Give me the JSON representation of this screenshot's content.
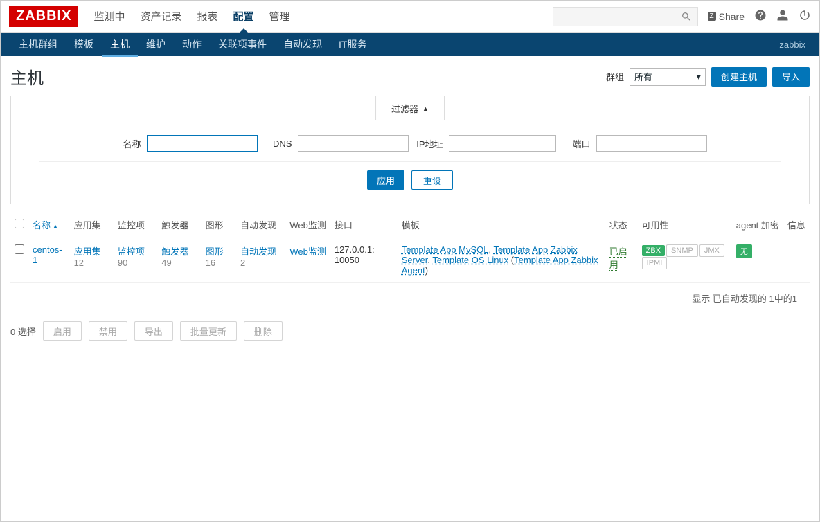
{
  "logo": "ZABBIX",
  "mainnav": {
    "items": [
      "监测中",
      "资产记录",
      "报表",
      "配置",
      "管理"
    ],
    "active_index": 3
  },
  "toptools": {
    "share": "Share",
    "share_badge": "Z"
  },
  "subnav": {
    "items": [
      "主机群组",
      "模板",
      "主机",
      "维护",
      "动作",
      "关联项事件",
      "自动发现",
      "IT服务"
    ],
    "active_index": 2,
    "right": "zabbix"
  },
  "page": {
    "title": "主机",
    "group_label": "群组",
    "group_value": "所有",
    "create_btn": "创建主机",
    "import_btn": "导入"
  },
  "filter": {
    "tab": "过滤器",
    "name_label": "名称",
    "dns_label": "DNS",
    "ip_label": "IP地址",
    "port_label": "端口",
    "apply": "应用",
    "reset": "重设"
  },
  "table": {
    "headers": {
      "name": "名称",
      "apps": "应用集",
      "items": "监控项",
      "triggers": "触发器",
      "graphs": "图形",
      "discovery": "自动发现",
      "web": "Web监测",
      "interface": "接口",
      "templates": "模板",
      "status": "状态",
      "availability": "可用性",
      "agent": "agent 加密",
      "info": "信息"
    },
    "rows": [
      {
        "name": "centos-1",
        "apps_label": "应用集",
        "apps_count": "12",
        "items_label": "监控项",
        "items_count": "90",
        "triggers_label": "触发器",
        "triggers_count": "49",
        "graphs_label": "图形",
        "graphs_count": "16",
        "discovery_label": "自动发现",
        "discovery_count": "2",
        "web_label": "Web监测",
        "interface": "127.0.0.1: 10050",
        "templates": {
          "t1": "Template App MySQL",
          "sep1": ", ",
          "t2": "Template App Zabbix Server",
          "sep2": ", ",
          "t3": "Template OS Linux",
          "paren_open": " (",
          "t4": "Template App Zabbix Agent",
          "paren_close": ")"
        },
        "status": "已启用",
        "avail": {
          "zbx": "ZBX",
          "snmp": "SNMP",
          "jmx": "JMX",
          "ipmi": "IPMI"
        },
        "agent": "无"
      }
    ],
    "footer_info": "显示 已自动发现的 1中的1"
  },
  "actions": {
    "selected": "0 选择",
    "enable": "启用",
    "disable": "禁用",
    "export": "导出",
    "mass": "批量更新",
    "delete": "删除"
  }
}
